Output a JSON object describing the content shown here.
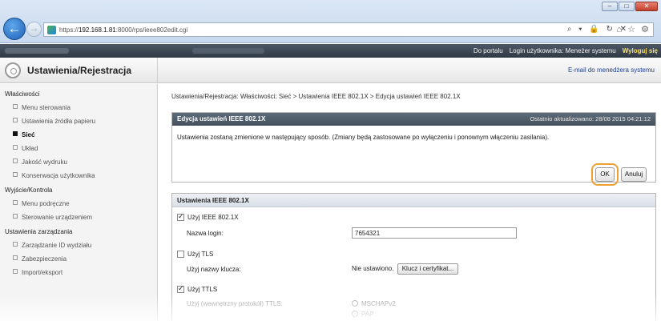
{
  "browser": {
    "url_prefix": "https://",
    "url_host": "192.168.1.81",
    "url_rest": ":8000/rps/ieee802edit.cgi",
    "search_hint": "⌕ ▾ 🔒 ↻ ✕",
    "window_controls": [
      "–",
      "□",
      "✕"
    ]
  },
  "header": {
    "portal_link": "Do portalu",
    "login_user": "Login użytkownika: Meneżer systemu",
    "logout": "Wyloguj się",
    "app_title": "Ustawienia/Rejestracja",
    "email_admin": "E-mail do menedżera systemu"
  },
  "sidebar": {
    "groups": [
      {
        "title": "Właściwości",
        "items": [
          "Menu sterowania",
          "Ustawienia źródła papieru",
          "Sieć",
          "Układ",
          "Jakość wydruku",
          "Konserwacja użytkownika"
        ]
      },
      {
        "title": "Wyjście/Kontrola",
        "items": [
          "Menu podręczne",
          "Sterowanie urządzeniem"
        ]
      },
      {
        "title": "Ustawienia zarządzania",
        "items": [
          "Zarządzanie ID wydziału",
          "Zabezpieczenia",
          "Import/eksport"
        ]
      }
    ],
    "active": "Sieć"
  },
  "main": {
    "breadcrumb": "Ustawienia/Rejestracja: Właściwości: Sieć > Ustawienia IEEE 802.1X > Edycja ustawień IEEE 802.1X",
    "panel_title": "Edycja ustawień IEEE 802.1X",
    "last_updated": "Ostatnio aktualizowano: 28/08 2015 04:21:12",
    "message": "Ustawienia zostaną zmienione w następujący sposób. (Zmiany będą zastosowane po wyłączeniu i ponownym włączeniu zasilania).",
    "ok_label": "OK",
    "cancel_label": "Anuluj",
    "section_title": "Ustawienia IEEE 802.1X",
    "use_ieee": "Użyj IEEE 802.1X",
    "login_name_label": "Nazwa login:",
    "login_name_value": "7654321",
    "use_tls": "Użyj TLS",
    "key_name_label": "Użyj nazwy klucza:",
    "key_name_value": "Nie ustawiono.",
    "key_cert_button": "Klucz i certyfikat...",
    "use_ttls": "Użyj TTLS",
    "ttls_protocol_label": "Użyj (wewnętrzny protokół) TTLS:",
    "ttls_option_1": "MSCHAPv2",
    "ttls_option_2": "PAP"
  }
}
